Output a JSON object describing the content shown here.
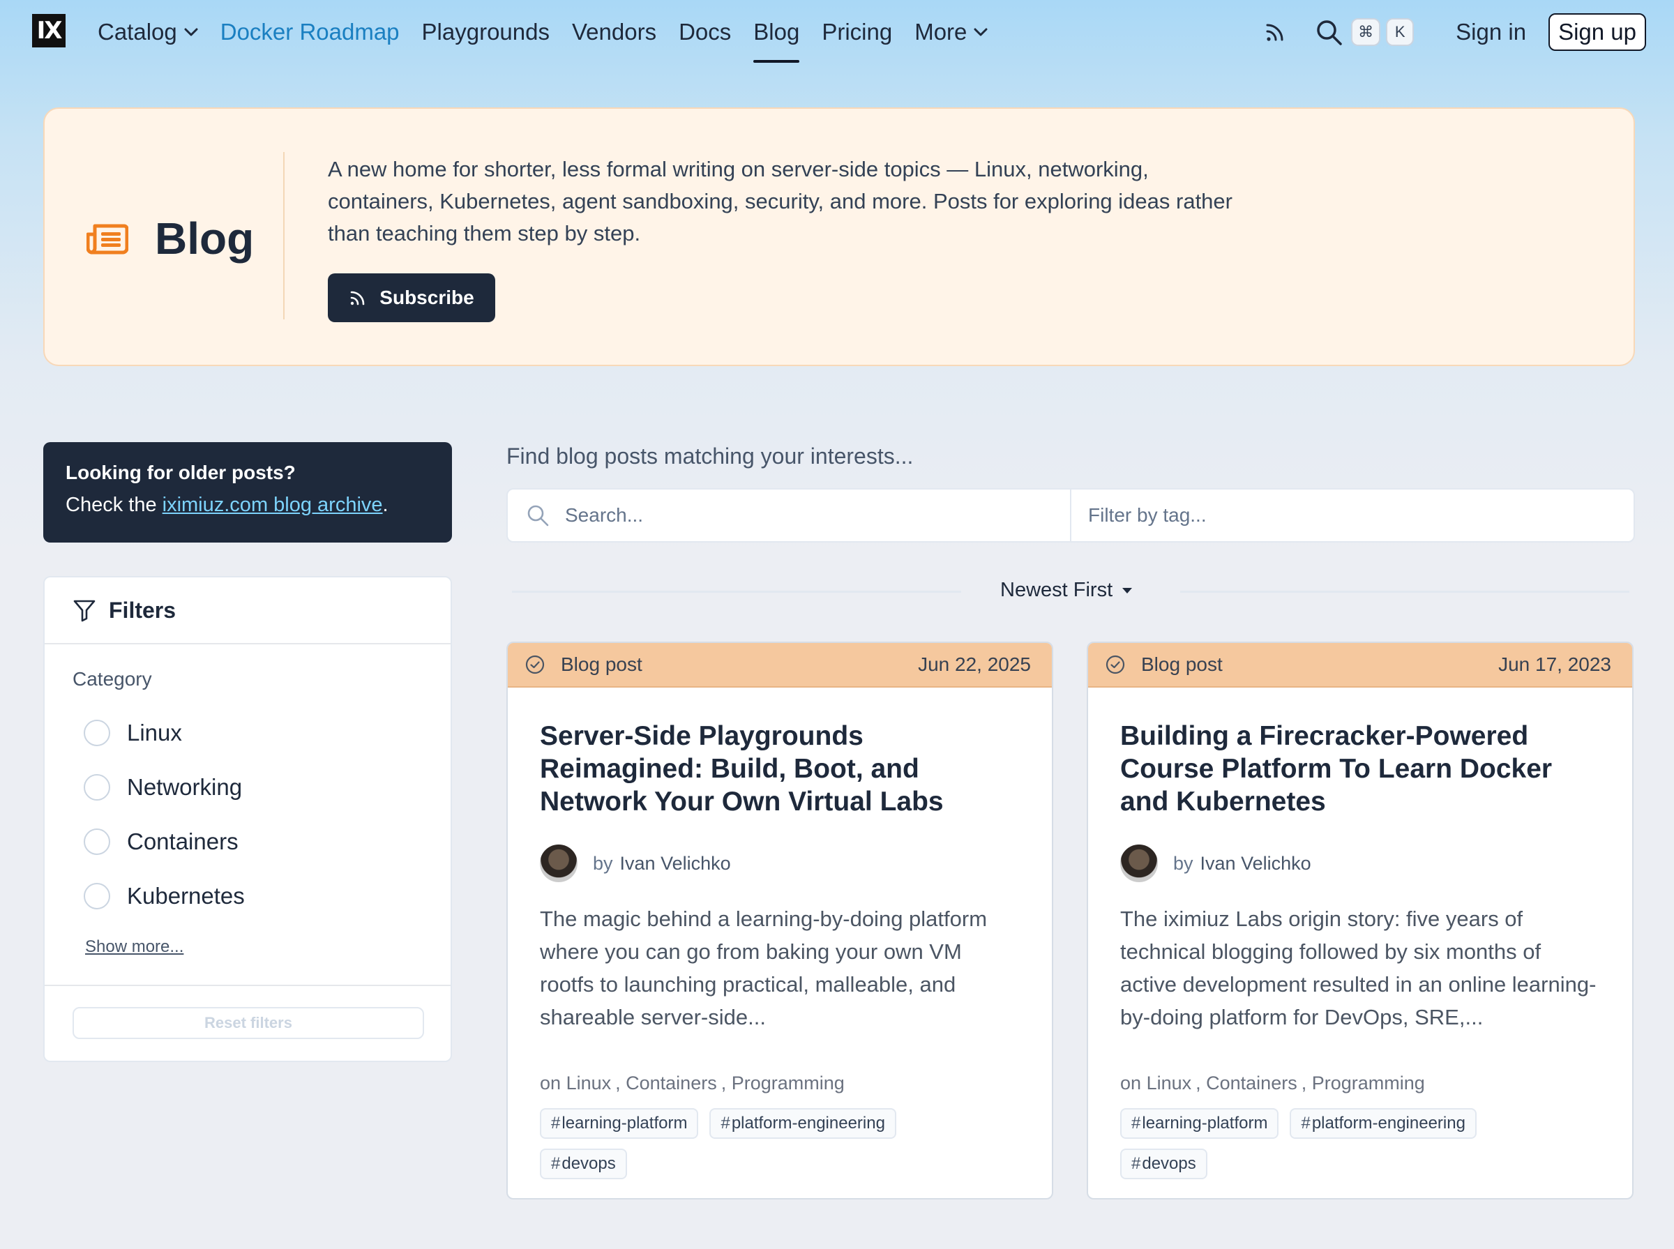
{
  "nav": {
    "logo": "IX",
    "items": [
      {
        "label": "Catalog",
        "dropdown": true
      },
      {
        "label": "Docker Roadmap",
        "accent": true
      },
      {
        "label": "Playgrounds"
      },
      {
        "label": "Vendors"
      },
      {
        "label": "Docs"
      },
      {
        "label": "Blog",
        "active": true
      },
      {
        "label": "Pricing"
      },
      {
        "label": "More",
        "dropdown": true
      }
    ],
    "kbd": [
      "⌘",
      "K"
    ],
    "sign_in": "Sign in",
    "sign_up": "Sign up"
  },
  "hero": {
    "title": "Blog",
    "description": "A new home for shorter, less formal writing on server-side topics — Linux, networking, containers, Kubernetes, agent sandboxing, security, and more. Posts for exploring ideas rather than teaching them step by step.",
    "subscribe_label": "Subscribe"
  },
  "older_posts": {
    "title": "Looking for older posts?",
    "text_before": "Check the ",
    "link_text": "iximiuz.com blog archive",
    "text_after": "."
  },
  "filters": {
    "title": "Filters",
    "category_label": "Category",
    "categories": [
      "Linux",
      "Networking",
      "Containers",
      "Kubernetes"
    ],
    "show_more": "Show more...",
    "reset": "Reset filters"
  },
  "search": {
    "heading": "Find blog posts matching your interests...",
    "search_placeholder": "Search...",
    "tag_placeholder": "Filter by tag...",
    "sort": "Newest First"
  },
  "posts": [
    {
      "type": "Blog post",
      "date": "Jun 22, 2025",
      "title": "Server-Side Playgrounds Reimagined: Build, Boot, and Network Your Own Virtual Labs",
      "by": "by",
      "author": "Ivan Velichko",
      "excerpt": "The magic behind a learning-by-doing platform where you can go from baking your own VM rootfs to launching practical, malleable, and shareable server-side...",
      "on": "on",
      "categories": [
        "Linux",
        "Containers",
        "Programming"
      ],
      "tags": [
        "learning-platform",
        "platform-engineering",
        "devops"
      ]
    },
    {
      "type": "Blog post",
      "date": "Jun 17, 2023",
      "title": "Building a Firecracker-Powered Course Platform To Learn Docker and Kubernetes",
      "by": "by",
      "author": "Ivan Velichko",
      "excerpt": "The iximiuz Labs origin story: five years of technical blogging followed by six months of active development resulted in an online learning-by-doing platform for DevOps, SRE,...",
      "on": "on",
      "categories": [
        "Linux",
        "Containers",
        "Programming"
      ],
      "tags": [
        "learning-platform",
        "platform-engineering",
        "devops"
      ]
    }
  ],
  "colors": {
    "accent_link": "#1a7fc1",
    "hero_bg": "#fff4e8",
    "card_header": "#f5c89e",
    "dark_panel": "#1e293b"
  },
  "icons": [
    "rss-icon",
    "search-icon",
    "chevron-down-icon",
    "newspaper-icon",
    "funnel-icon",
    "check-circle-icon",
    "caret-down-icon"
  ]
}
